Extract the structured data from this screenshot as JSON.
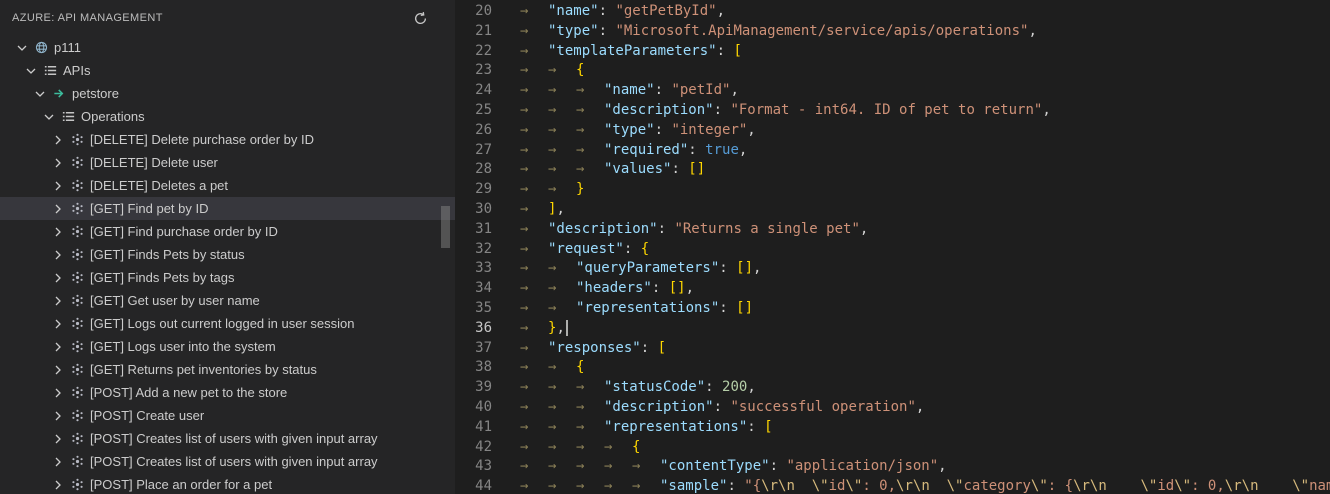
{
  "sidebar": {
    "header": {
      "title": "AZURE: API MANAGEMENT",
      "refresh_icon": "refresh-icon"
    },
    "tree": [
      {
        "label": "p111",
        "level": 0,
        "expanded": true,
        "icon": "service-icon",
        "selected": false
      },
      {
        "label": "APIs",
        "level": 1,
        "expanded": true,
        "icon": "list-icon",
        "selected": false
      },
      {
        "label": "petstore",
        "level": 2,
        "expanded": true,
        "icon": "api-icon",
        "selected": false
      },
      {
        "label": "Operations",
        "level": 3,
        "expanded": true,
        "icon": "list-icon",
        "selected": false
      },
      {
        "label": "[DELETE] Delete purchase order by ID",
        "level": 4,
        "expanded": false,
        "icon": "operation-icon",
        "selected": false
      },
      {
        "label": "[DELETE] Delete user",
        "level": 4,
        "expanded": false,
        "icon": "operation-icon",
        "selected": false
      },
      {
        "label": "[DELETE] Deletes a pet",
        "level": 4,
        "expanded": false,
        "icon": "operation-icon",
        "selected": false
      },
      {
        "label": "[GET] Find pet by ID",
        "level": 4,
        "expanded": false,
        "icon": "operation-icon",
        "selected": true
      },
      {
        "label": "[GET] Find purchase order by ID",
        "level": 4,
        "expanded": false,
        "icon": "operation-icon",
        "selected": false
      },
      {
        "label": "[GET] Finds Pets by status",
        "level": 4,
        "expanded": false,
        "icon": "operation-icon",
        "selected": false
      },
      {
        "label": "[GET] Finds Pets by tags",
        "level": 4,
        "expanded": false,
        "icon": "operation-icon",
        "selected": false
      },
      {
        "label": "[GET] Get user by user name",
        "level": 4,
        "expanded": false,
        "icon": "operation-icon",
        "selected": false
      },
      {
        "label": "[GET] Logs out current logged in user session",
        "level": 4,
        "expanded": false,
        "icon": "operation-icon",
        "selected": false
      },
      {
        "label": "[GET] Logs user into the system",
        "level": 4,
        "expanded": false,
        "icon": "operation-icon",
        "selected": false
      },
      {
        "label": "[GET] Returns pet inventories by status",
        "level": 4,
        "expanded": false,
        "icon": "operation-icon",
        "selected": false
      },
      {
        "label": "[POST] Add a new pet to the store",
        "level": 4,
        "expanded": false,
        "icon": "operation-icon",
        "selected": false
      },
      {
        "label": "[POST] Create user",
        "level": 4,
        "expanded": false,
        "icon": "operation-icon",
        "selected": false
      },
      {
        "label": "[POST] Creates list of users with given input array",
        "level": 4,
        "expanded": false,
        "icon": "operation-icon",
        "selected": false
      },
      {
        "label": "[POST] Creates list of users with given input array",
        "level": 4,
        "expanded": false,
        "icon": "operation-icon",
        "selected": false
      },
      {
        "label": "[POST] Place an order for a pet",
        "level": 4,
        "expanded": false,
        "icon": "operation-icon",
        "selected": false
      }
    ]
  },
  "editor": {
    "language": "json",
    "active_line": 36,
    "tab_glyph": "→",
    "lines": [
      {
        "n": 20,
        "indent": 1,
        "tokens": [
          {
            "c": "key",
            "t": "\"name\""
          },
          {
            "c": "punc",
            "t": ": "
          },
          {
            "c": "str",
            "t": "\"getPetById\""
          },
          {
            "c": "punc",
            "t": ","
          }
        ]
      },
      {
        "n": 21,
        "indent": 1,
        "tokens": [
          {
            "c": "key",
            "t": "\"type\""
          },
          {
            "c": "punc",
            "t": ": "
          },
          {
            "c": "str",
            "t": "\"Microsoft.ApiManagement/service/apis/operations\""
          },
          {
            "c": "punc",
            "t": ","
          }
        ]
      },
      {
        "n": 22,
        "indent": 1,
        "tokens": [
          {
            "c": "key",
            "t": "\"templateParameters\""
          },
          {
            "c": "punc",
            "t": ": "
          },
          {
            "c": "brk",
            "t": "["
          }
        ]
      },
      {
        "n": 23,
        "indent": 2,
        "tokens": [
          {
            "c": "brk",
            "t": "{"
          }
        ]
      },
      {
        "n": 24,
        "indent": 3,
        "tokens": [
          {
            "c": "key",
            "t": "\"name\""
          },
          {
            "c": "punc",
            "t": ": "
          },
          {
            "c": "str",
            "t": "\"petId\""
          },
          {
            "c": "punc",
            "t": ","
          }
        ]
      },
      {
        "n": 25,
        "indent": 3,
        "tokens": [
          {
            "c": "key",
            "t": "\"description\""
          },
          {
            "c": "punc",
            "t": ": "
          },
          {
            "c": "str",
            "t": "\"Format - int64. ID of pet to return\""
          },
          {
            "c": "punc",
            "t": ","
          }
        ]
      },
      {
        "n": 26,
        "indent": 3,
        "tokens": [
          {
            "c": "key",
            "t": "\"type\""
          },
          {
            "c": "punc",
            "t": ": "
          },
          {
            "c": "str",
            "t": "\"integer\""
          },
          {
            "c": "punc",
            "t": ","
          }
        ]
      },
      {
        "n": 27,
        "indent": 3,
        "tokens": [
          {
            "c": "key",
            "t": "\"required\""
          },
          {
            "c": "punc",
            "t": ": "
          },
          {
            "c": "kw",
            "t": "true"
          },
          {
            "c": "punc",
            "t": ","
          }
        ]
      },
      {
        "n": 28,
        "indent": 3,
        "tokens": [
          {
            "c": "key",
            "t": "\"values\""
          },
          {
            "c": "punc",
            "t": ": "
          },
          {
            "c": "brk",
            "t": "[]"
          }
        ]
      },
      {
        "n": 29,
        "indent": 2,
        "tokens": [
          {
            "c": "brk",
            "t": "}"
          }
        ]
      },
      {
        "n": 30,
        "indent": 1,
        "tokens": [
          {
            "c": "brk",
            "t": "]"
          },
          {
            "c": "punc",
            "t": ","
          }
        ]
      },
      {
        "n": 31,
        "indent": 1,
        "tokens": [
          {
            "c": "key",
            "t": "\"description\""
          },
          {
            "c": "punc",
            "t": ": "
          },
          {
            "c": "str",
            "t": "\"Returns a single pet\""
          },
          {
            "c": "punc",
            "t": ","
          }
        ]
      },
      {
        "n": 32,
        "indent": 1,
        "tokens": [
          {
            "c": "key",
            "t": "\"request\""
          },
          {
            "c": "punc",
            "t": ": "
          },
          {
            "c": "brk",
            "t": "{"
          }
        ]
      },
      {
        "n": 33,
        "indent": 2,
        "tokens": [
          {
            "c": "key",
            "t": "\"queryParameters\""
          },
          {
            "c": "punc",
            "t": ": "
          },
          {
            "c": "brk",
            "t": "[]"
          },
          {
            "c": "punc",
            "t": ","
          }
        ]
      },
      {
        "n": 34,
        "indent": 2,
        "tokens": [
          {
            "c": "key",
            "t": "\"headers\""
          },
          {
            "c": "punc",
            "t": ": "
          },
          {
            "c": "brk",
            "t": "[]"
          },
          {
            "c": "punc",
            "t": ","
          }
        ]
      },
      {
        "n": 35,
        "indent": 2,
        "tokens": [
          {
            "c": "key",
            "t": "\"representations\""
          },
          {
            "c": "punc",
            "t": ": "
          },
          {
            "c": "brk",
            "t": "[]"
          }
        ]
      },
      {
        "n": 36,
        "indent": 1,
        "cursor": true,
        "tokens": [
          {
            "c": "brk",
            "t": "}"
          },
          {
            "c": "punc",
            "t": ","
          }
        ]
      },
      {
        "n": 37,
        "indent": 1,
        "tokens": [
          {
            "c": "key",
            "t": "\"responses\""
          },
          {
            "c": "punc",
            "t": ": "
          },
          {
            "c": "brk",
            "t": "["
          }
        ]
      },
      {
        "n": 38,
        "indent": 2,
        "tokens": [
          {
            "c": "brk",
            "t": "{"
          }
        ]
      },
      {
        "n": 39,
        "indent": 3,
        "tokens": [
          {
            "c": "key",
            "t": "\"statusCode\""
          },
          {
            "c": "punc",
            "t": ": "
          },
          {
            "c": "num",
            "t": "200"
          },
          {
            "c": "punc",
            "t": ","
          }
        ]
      },
      {
        "n": 40,
        "indent": 3,
        "tokens": [
          {
            "c": "key",
            "t": "\"description\""
          },
          {
            "c": "punc",
            "t": ": "
          },
          {
            "c": "str",
            "t": "\"successful operation\""
          },
          {
            "c": "punc",
            "t": ","
          }
        ]
      },
      {
        "n": 41,
        "indent": 3,
        "tokens": [
          {
            "c": "key",
            "t": "\"representations\""
          },
          {
            "c": "punc",
            "t": ": "
          },
          {
            "c": "brk",
            "t": "["
          }
        ]
      },
      {
        "n": 42,
        "indent": 4,
        "tokens": [
          {
            "c": "brk",
            "t": "{"
          }
        ]
      },
      {
        "n": 43,
        "indent": 5,
        "tokens": [
          {
            "c": "key",
            "t": "\"contentType\""
          },
          {
            "c": "punc",
            "t": ": "
          },
          {
            "c": "str",
            "t": "\"application/json\""
          },
          {
            "c": "punc",
            "t": ","
          }
        ]
      },
      {
        "n": 44,
        "indent": 5,
        "tokens": [
          {
            "c": "key",
            "t": "\"sample\""
          },
          {
            "c": "punc",
            "t": ": "
          },
          {
            "c": "str",
            "t": "\"{"
          },
          {
            "c": "esc",
            "t": "\\r\\n"
          },
          {
            "c": "str",
            "t": "  "
          },
          {
            "c": "esc",
            "t": "\\\""
          },
          {
            "c": "str",
            "t": "id"
          },
          {
            "c": "esc",
            "t": "\\\""
          },
          {
            "c": "str",
            "t": ": 0,"
          },
          {
            "c": "esc",
            "t": "\\r\\n"
          },
          {
            "c": "str",
            "t": "  "
          },
          {
            "c": "esc",
            "t": "\\\""
          },
          {
            "c": "str",
            "t": "category"
          },
          {
            "c": "esc",
            "t": "\\\""
          },
          {
            "c": "str",
            "t": ": {"
          },
          {
            "c": "esc",
            "t": "\\r\\n"
          },
          {
            "c": "str",
            "t": "    "
          },
          {
            "c": "esc",
            "t": "\\\""
          },
          {
            "c": "str",
            "t": "id"
          },
          {
            "c": "esc",
            "t": "\\\""
          },
          {
            "c": "str",
            "t": ": 0,"
          },
          {
            "c": "esc",
            "t": "\\r\\n"
          },
          {
            "c": "str",
            "t": "    "
          },
          {
            "c": "esc",
            "t": "\\\""
          },
          {
            "c": "str",
            "t": "name"
          }
        ]
      }
    ]
  },
  "colors": {
    "editor_background": "#1e1e1e",
    "sidebar_background": "#252526",
    "selection_background": "#37373d",
    "json_key": "#9cdcfe",
    "json_string": "#ce9178",
    "json_escape": "#d7ba7d",
    "json_number": "#b5cea8",
    "json_keyword": "#569cd6",
    "punctuation": "#d4d4d4",
    "bracket": "#ffd700",
    "line_number": "#858585",
    "active_line_number": "#c6c6c6",
    "whitespace_tab": "#8a7f56",
    "api_icon_accent": "#3dbd9d"
  }
}
